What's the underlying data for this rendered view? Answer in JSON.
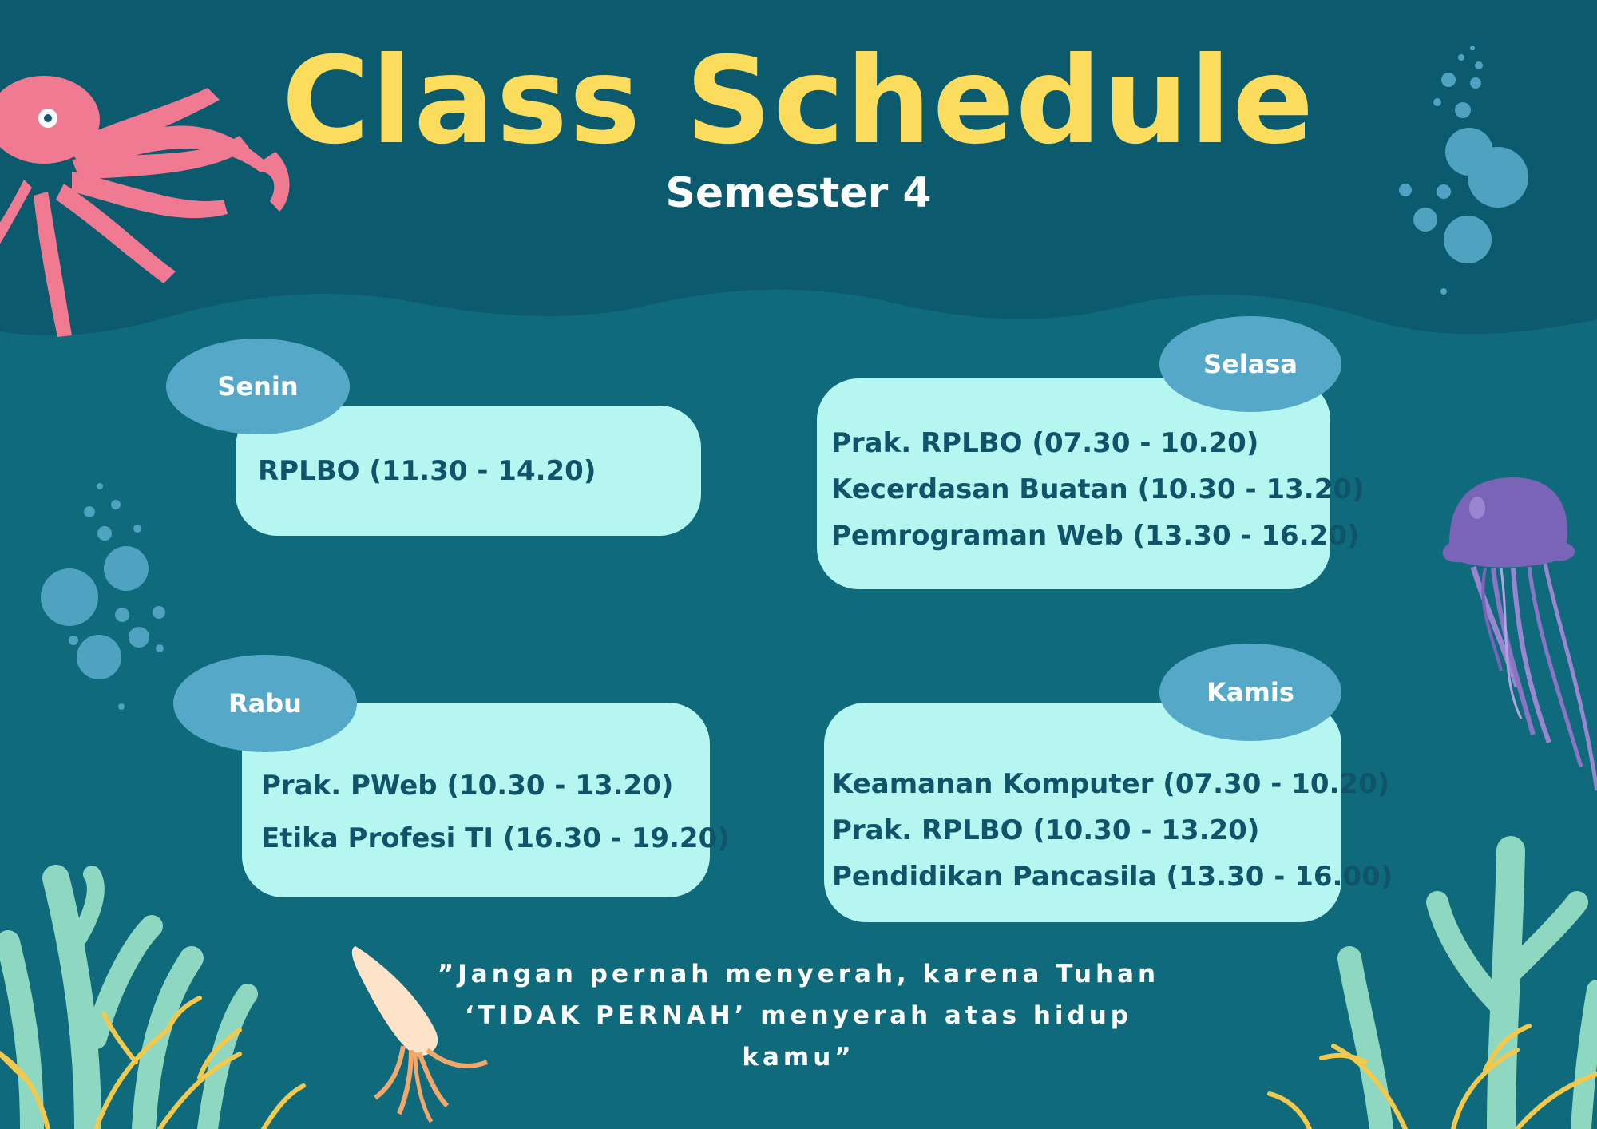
{
  "header": {
    "title": "Class Schedule",
    "subtitle": "Semester 4"
  },
  "days": [
    {
      "name": "Senin",
      "entries": [
        "RPLBO (11.30 - 14.20)"
      ]
    },
    {
      "name": "Selasa",
      "entries": [
        "Prak. RPLBO  (07.30 - 10.20)",
        "Kecerdasan Buatan (10.30 - 13.20)",
        "Pemrograman Web (13.30 - 16.20)"
      ]
    },
    {
      "name": "Rabu",
      "entries": [
        "Prak. PWeb (10.30 - 13.20)",
        "Etika Profesi TI (16.30 - 19.20)"
      ]
    },
    {
      "name": "Kamis",
      "entries": [
        "Keamanan Komputer (07.30 - 10.20)",
        "Prak. RPLBO (10.30 - 13.20)",
        "Pendidikan Pancasila (13.30 - 16.00)"
      ]
    }
  ],
  "quote": {
    "line1": "”Jangan pernah menyerah, karena Tuhan",
    "line2": "‘TIDAK PERNAH’ menyerah atas hidup",
    "line3": "kamu”"
  },
  "colors": {
    "background_top": "#0c5a6d",
    "background": "#0f6a7c",
    "title": "#fcdc5c",
    "card": "#b5f6f1",
    "pill": "#56a8c8",
    "card_text": "#10546a",
    "octopus": "#f07a92",
    "jellyfish": "#7a64b8",
    "bubbles": "#4fa3c0",
    "coral": "#8ed8c2",
    "seaweed": "#f2c94c"
  },
  "decorations": [
    "octopus-icon",
    "jellyfish-icon",
    "squid-icon",
    "bubbles-icon",
    "coral-icon",
    "seaweed-icon"
  ]
}
